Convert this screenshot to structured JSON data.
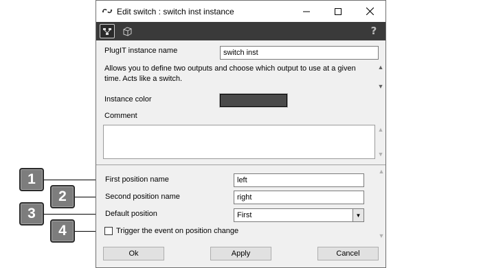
{
  "window": {
    "title": "Edit switch : switch inst instance",
    "help_glyph": "?"
  },
  "form": {
    "instance_name_label": "PlugIT instance name",
    "instance_name_value": "switch inst",
    "description": "Allows you to define two outputs and choose which output to use at a given time. Acts like a switch.",
    "instance_color_label": "Instance color",
    "instance_color_value": "#4a4a4a",
    "comment_label": "Comment",
    "comment_value": "",
    "first_position_label": "First position name",
    "first_position_value": "left",
    "second_position_label": "Second position name",
    "second_position_value": "right",
    "default_position_label": "Default position",
    "default_position_value": "First",
    "trigger_label": "Trigger the event on position change",
    "trigger_checked": false
  },
  "buttons": {
    "ok": "Ok",
    "apply": "Apply",
    "cancel": "Cancel"
  },
  "callouts": [
    "1",
    "2",
    "3",
    "4"
  ],
  "icons": {
    "title": "link-icon",
    "toolbar": [
      "diagram-icon",
      "cube-icon"
    ],
    "help": "help-icon"
  }
}
